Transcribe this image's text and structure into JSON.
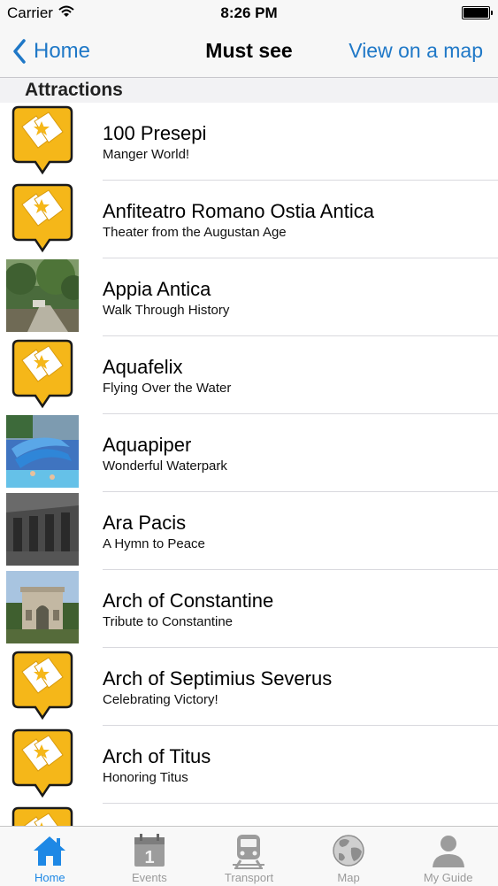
{
  "status_bar": {
    "carrier": "Carrier",
    "time": "8:26 PM"
  },
  "nav": {
    "back_label": "Home",
    "title": "Must see",
    "right_label": "View on a map"
  },
  "section_header": "Attractions",
  "items": [
    {
      "title": "100 Presepi",
      "subtitle": "Manger World!",
      "thumb": "placeholder"
    },
    {
      "title": "Anfiteatro Romano Ostia Antica",
      "subtitle": "Theater from the Augustan Age",
      "thumb": "placeholder"
    },
    {
      "title": "Appia Antica",
      "subtitle": "Walk Through History",
      "thumb": "photo-road"
    },
    {
      "title": "Aquafelix",
      "subtitle": "Flying Over the Water",
      "thumb": "placeholder"
    },
    {
      "title": "Aquapiper",
      "subtitle": "Wonderful Waterpark",
      "thumb": "photo-waterslide"
    },
    {
      "title": "Ara Pacis",
      "subtitle": "A Hymn to Peace",
      "thumb": "photo-interior"
    },
    {
      "title": "Arch of Constantine",
      "subtitle": "Tribute to Constantine",
      "thumb": "photo-arch"
    },
    {
      "title": "Arch of Septimius Severus",
      "subtitle": "Celebrating Victory!",
      "thumb": "placeholder"
    },
    {
      "title": "Arch of Titus",
      "subtitle": "Honoring Titus",
      "thumb": "placeholder"
    },
    {
      "title": "",
      "subtitle": "",
      "thumb": "placeholder"
    }
  ],
  "tabs": [
    {
      "label": "Home",
      "icon": "home-icon",
      "active": true
    },
    {
      "label": "Events",
      "icon": "calendar-icon",
      "active": false
    },
    {
      "label": "Transport",
      "icon": "train-icon",
      "active": false
    },
    {
      "label": "Map",
      "icon": "globe-icon",
      "active": false
    },
    {
      "label": "My Guide",
      "icon": "person-icon",
      "active": false
    }
  ],
  "colors": {
    "accent": "#1f78c7",
    "tab_active": "#1e88e5",
    "placeholder_yellow": "#f5b719"
  }
}
